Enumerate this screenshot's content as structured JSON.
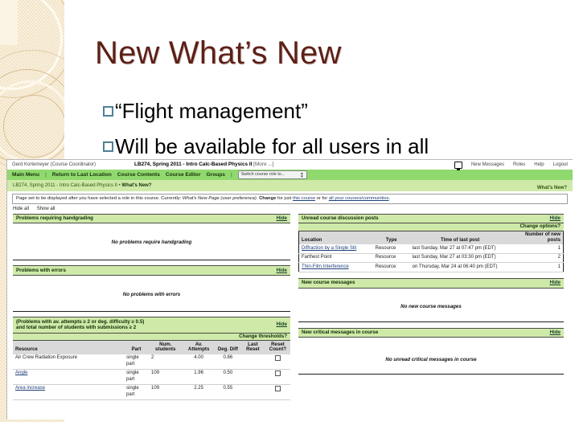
{
  "slide": {
    "title": "New What’s New",
    "bullets": [
      "“Flight management”",
      "Will be available for all users in all"
    ]
  },
  "colors": {
    "title": "#5c2017",
    "bullet_square": "#4f7f96",
    "menu_green": "#90d96e",
    "section_green": "#cfeaa8",
    "sidebar_beige": "#f3e4c6"
  },
  "lon": {
    "topbar": {
      "user": "Gerd Kortemeyer (Course Coordinator)",
      "course": "LB274, Spring 2011 - Intro Calc-Based Physics II",
      "more": "[More ...]",
      "messages_icon": "message-icon",
      "links": [
        "New Messages",
        "Roles",
        "Help",
        "Logout"
      ]
    },
    "menu": {
      "items": [
        "Main Menu",
        "Return to Last Location",
        "Course Contents",
        "Course Editor",
        "Groups"
      ],
      "separators": "|",
      "role_select_value": "Switch course role to..."
    },
    "breadcrumb": {
      "path": "LB274, Spring 2011 - Intro Calc-Based Physics II",
      "arrow": "•",
      "current": "What's New?",
      "right_label": "What's New?"
    },
    "notice": {
      "pre": "Page set to be displayed after you have selected a role in this course. Currently:",
      "italic": "What's New Page (user preference).",
      "change": "Change",
      "mid": "for just",
      "link1": "this course",
      "or": "or for",
      "link2": "all your courses/communities",
      "end": "."
    },
    "hide_all": "Hide all",
    "show_all": "Show all",
    "left_sections": [
      {
        "title": "Problems requiring handgrading",
        "hide": "Hide",
        "empty_message": "No problems require handgrading"
      },
      {
        "title": "Problems with errors",
        "hide": "Hide",
        "empty_message": "No problems with errors"
      }
    ],
    "problems_section": {
      "title_line1": "(Problems with av. attempts ≥ 2 or deg. difficulty ≥ 0.5)",
      "title_line2": "and total number of students with submissions ≥ 2",
      "hide": "Hide",
      "change_thresholds": "Change thresholds?",
      "columns": [
        "Resource",
        "Part",
        "Num. students",
        "Av. Attempts",
        "Deg. Diff",
        "Last Reset",
        "Reset Count?"
      ],
      "rows": [
        {
          "resource": "Air Crew Radiation Exposure",
          "link": false,
          "part": "single part",
          "num_students": "2",
          "av_attempts": "4.00",
          "deg_diff": "0.86",
          "last_reset": "",
          "reset_count": "checkbox"
        },
        {
          "resource": "Angle",
          "link": true,
          "part": "single part",
          "num_students": "109",
          "av_attempts": "1.96",
          "deg_diff": "0.50",
          "last_reset": "",
          "reset_count": "checkbox"
        },
        {
          "resource": "Area increase",
          "link": true,
          "part": "single part",
          "num_students": "109",
          "av_attempts": "2.25",
          "deg_diff": "0.55",
          "last_reset": "",
          "reset_count": "checkbox"
        }
      ]
    },
    "discussion_section": {
      "title": "Unread course discussion posts",
      "hide": "Hide",
      "change_options": "Change options?",
      "columns": [
        "Location",
        "Type",
        "Time of last post",
        "Number of new posts"
      ],
      "rows": [
        {
          "location": "Diffraction by a Single Slit",
          "link": true,
          "type": "Resource",
          "time": "last Sunday, Mar 27 at 07:47 pm (EDT)",
          "count": "1"
        },
        {
          "location": "Farthest Point",
          "link": false,
          "type": "Resource",
          "time": "last Sunday, Mar 27 at 03:30 pm (EDT)",
          "count": "2"
        },
        {
          "location": "Thin-Film Interference",
          "link": true,
          "type": "Resource",
          "time": "on Thursday, Mar 24 at 06:40 pm (EDT)",
          "count": "1"
        }
      ]
    },
    "right_sections": [
      {
        "title": "New course messages",
        "hide": "Hide",
        "empty_message": "No new course messages"
      },
      {
        "title": "New critical messages in course",
        "hide": "Hide",
        "empty_message": "No unread critical messages in course"
      }
    ]
  }
}
